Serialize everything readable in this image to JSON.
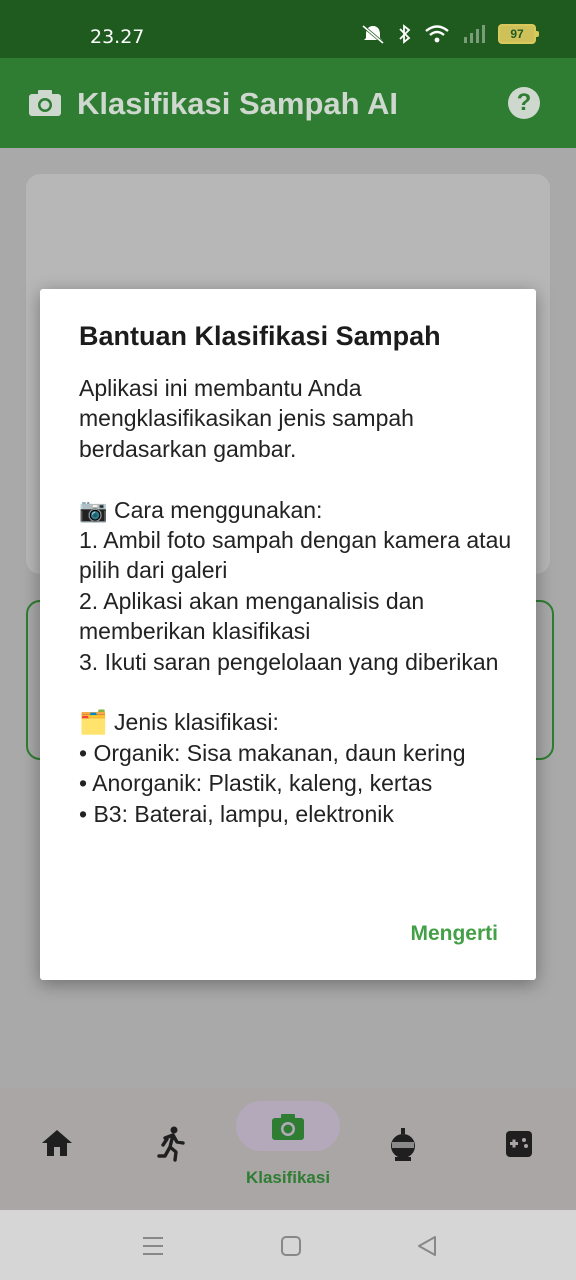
{
  "status_bar": {
    "time": "23.27",
    "battery": "97"
  },
  "app_bar": {
    "title": "Klasifikasi Sampah AI",
    "help_icon": "help-circle-icon",
    "camera_icon": "camera-icon"
  },
  "dialog": {
    "title": "Bantuan Klasifikasi Sampah",
    "body": "Aplikasi ini membantu Anda mengklasifikasikan jenis sampah berdasarkan gambar.\n\n📷 Cara menggunakan:\n1. Ambil foto sampah dengan kamera atau pilih dari galeri\n2. Aplikasi akan menganalisis dan memberikan klasifikasi\n3. Ikuti saran pengelolaan yang diberikan\n\n🗂️ Jenis klasifikasi:\n• Organik: Sisa makanan, daun kering\n• Anorganik: Plastik, kaleng, kertas\n• B3: Baterai, lampu, elektronik",
    "confirm_label": "Mengerti"
  },
  "bottom_nav": {
    "items": [
      {
        "icon": "home-icon"
      },
      {
        "icon": "run-icon"
      },
      {
        "icon": "camera-icon",
        "label": "Klasifikasi",
        "selected": true
      },
      {
        "icon": "robot-icon"
      },
      {
        "icon": "gamepad-icon"
      }
    ]
  },
  "colors": {
    "primary": "#2e7d32",
    "accent": "#43a047",
    "status_bar": "#1f5b1f"
  }
}
